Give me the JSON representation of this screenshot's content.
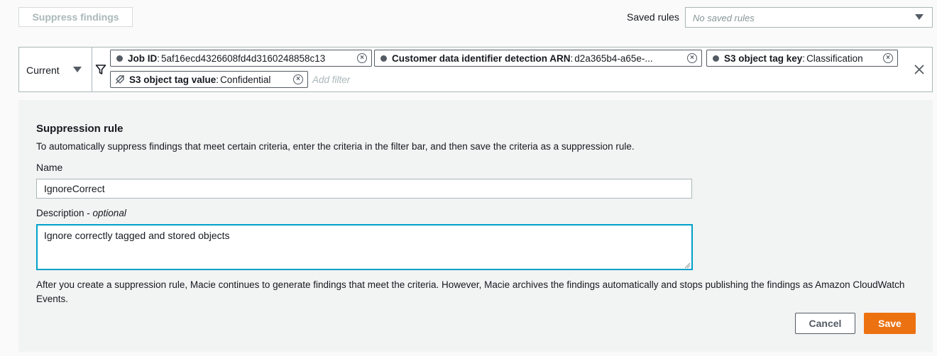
{
  "toolbar": {
    "suppress_label": "Suppress findings",
    "saved_rules_label": "Saved rules",
    "saved_rules_placeholder": "No saved rules"
  },
  "filter_bar": {
    "scope_value": "Current",
    "add_filter_placeholder": "Add filter",
    "chips": [
      {
        "key": "Job ID",
        "value": "5af16ecd4326608fd4d3160248858c13",
        "icon": "dot-icon"
      },
      {
        "key": "Customer data identifier detection ARN",
        "value": "d2a365b4-a65e-...",
        "icon": "dot-icon"
      },
      {
        "key": "S3 object tag key",
        "value": "Classification",
        "icon": "dot-icon"
      },
      {
        "key": "S3 object tag value",
        "value": "Confidential",
        "icon": "tag-off-icon"
      }
    ],
    "clear_icon": "close-icon",
    "filter_icon": "funnel-icon"
  },
  "suppression": {
    "title": "Suppression rule",
    "description": "To automatically suppress findings that meet certain criteria, enter the criteria in the filter bar, and then save the criteria as a suppression rule.",
    "name_label": "Name",
    "name_value": "IgnoreCorrect",
    "description_label": "Description - ",
    "description_optional": "optional",
    "description_value": "Ignore correctly tagged and stored objects",
    "note": "After you create a suppression rule, Macie continues to generate findings that meet the criteria. However, Macie archives the findings automatically and stops publishing the findings as Amazon CloudWatch Events.",
    "cancel_label": "Cancel",
    "save_label": "Save"
  },
  "colors": {
    "accent_orange": "#ec7211",
    "focus_blue": "#00a1c9",
    "border_gray": "#aab7b8"
  }
}
